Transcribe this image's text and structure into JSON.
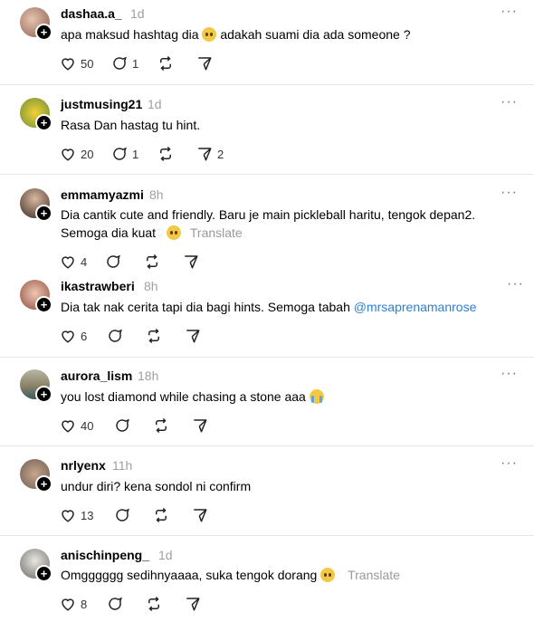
{
  "comments": [
    {
      "username": "dashaa.a_",
      "time": "1d",
      "text": "apa maksud hashtag dia",
      "text_after": "adakah suami dia ada someone ?",
      "emoji": "pleading-face-emoji",
      "likes": "50",
      "replies": "1",
      "shares": "",
      "translate": ""
    },
    {
      "username": "justmusing21",
      "time": "1d",
      "text": "Rasa Dan hastag tu hint.",
      "likes": "20",
      "replies": "1",
      "shares": "2",
      "translate": ""
    },
    {
      "username": "emmamyazmi",
      "time": "8h",
      "text": "Dia cantik cute and friendly. Baru je main pickleball haritu, tengok depan2.",
      "text_line2": "Semoga dia kuat",
      "translate": "Translate",
      "likes": "4",
      "replies": "",
      "shares": ""
    },
    {
      "username": "ikastrawberi",
      "time": "8h",
      "text": "Dia tak nak cerita tapi dia bagi hints. Semoga tabah",
      "mention": "@mrsaprenamanrose",
      "likes": "6",
      "replies": "",
      "shares": ""
    },
    {
      "username": "aurora_lism",
      "time": "18h",
      "text": "you lost diamond while chasing a stone aaa",
      "emoji": "sob-emoji",
      "likes": "40",
      "replies": "",
      "shares": ""
    },
    {
      "username": "nrlyenx",
      "time": "11h",
      "text": "undur diri? kena sondol ni confirm",
      "likes": "13",
      "replies": "",
      "shares": ""
    },
    {
      "username": "anischinpeng_",
      "time": "1d",
      "text": "Omgggggg sedihnyaaaa, suka tengok dorang",
      "translate": "Translate",
      "likes": "8",
      "replies": "",
      "shares": ""
    }
  ],
  "icons": {
    "like": "heart-icon",
    "reply": "comment-icon",
    "repost": "repost-icon",
    "share": "send-icon",
    "more": "more-icon",
    "follow": "plus-icon"
  },
  "colors": {
    "mention": "#2f7fd0",
    "muted": "#a0a0a0",
    "divider": "#e6e6e6"
  },
  "more_glyph": "···",
  "plus_glyph": "+"
}
